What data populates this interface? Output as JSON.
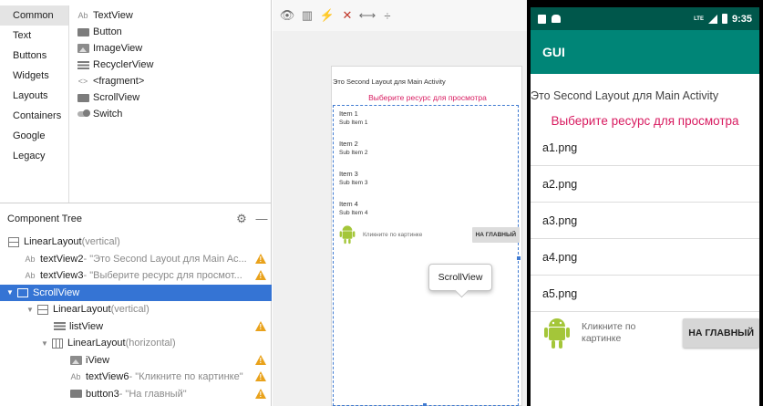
{
  "palette": {
    "categories": [
      "Common",
      "Text",
      "Buttons",
      "Widgets",
      "Layouts",
      "Containers",
      "Google",
      "Legacy"
    ],
    "selected_category": "Common",
    "widgets": [
      {
        "label": "TextView",
        "icon": "textview-icon"
      },
      {
        "label": "Button",
        "icon": "button-icon"
      },
      {
        "label": "ImageView",
        "icon": "imageview-icon"
      },
      {
        "label": "RecyclerView",
        "icon": "list-icon"
      },
      {
        "label": "<fragment>",
        "icon": "code-brackets-icon"
      },
      {
        "label": "ScrollView",
        "icon": "scrollview-icon"
      },
      {
        "label": "Switch",
        "icon": "switch-icon"
      }
    ]
  },
  "component_tree": {
    "title": "Component Tree",
    "nodes": [
      {
        "name": "LinearLayout",
        "detail": "(vertical)",
        "warn": false
      },
      {
        "name": "textView2",
        "detail": "- \"Это Second Layout для Main Ac...",
        "warn": true
      },
      {
        "name": "textView3",
        "detail": "- \"Выберите ресурс для просмот...",
        "warn": true
      },
      {
        "name": "ScrollView",
        "detail": "",
        "warn": false
      },
      {
        "name": "LinearLayout",
        "detail": "(vertical)",
        "warn": false
      },
      {
        "name": "listView",
        "detail": "",
        "warn": true
      },
      {
        "name": "LinearLayout",
        "detail": "(horizontal)",
        "warn": false
      },
      {
        "name": "iView",
        "detail": "",
        "warn": true
      },
      {
        "name": "textView6",
        "detail": "- \"Кликните по картинке\"",
        "warn": true
      },
      {
        "name": "button3",
        "detail": "- \"На главный\"",
        "warn": true
      }
    ]
  },
  "design": {
    "title_text": "Это Second Layout для Main Activity",
    "subtitle_text": "Выберите ресурс для просмотра",
    "items": [
      {
        "title": "Item 1",
        "sub": "Sub Item 1"
      },
      {
        "title": "Item 2",
        "sub": "Sub Item 2"
      },
      {
        "title": "Item 3",
        "sub": "Sub Item 3"
      },
      {
        "title": "Item 4",
        "sub": "Sub Item 4"
      }
    ],
    "click_text": "Кликните по картинке",
    "button_text": "НА ГЛАВНЫЙ",
    "tooltip": "ScrollView"
  },
  "phone": {
    "time": "9:35",
    "network": "LTE",
    "app_title": "GUI",
    "title_text": "Это Second Layout для Main Activity",
    "subtitle_text": "Выберите ресурс для просмотра",
    "files": [
      "a1.png",
      "a2.png",
      "a3.png",
      "a4.png",
      "a5.png"
    ],
    "click_text": "Кликните по картинке",
    "button_text": "НА ГЛАВНЫЙ",
    "colors": {
      "status_bar": "#00574b",
      "app_bar": "#008577",
      "accent": "#d81b60",
      "android_green": "#a4c639"
    }
  }
}
